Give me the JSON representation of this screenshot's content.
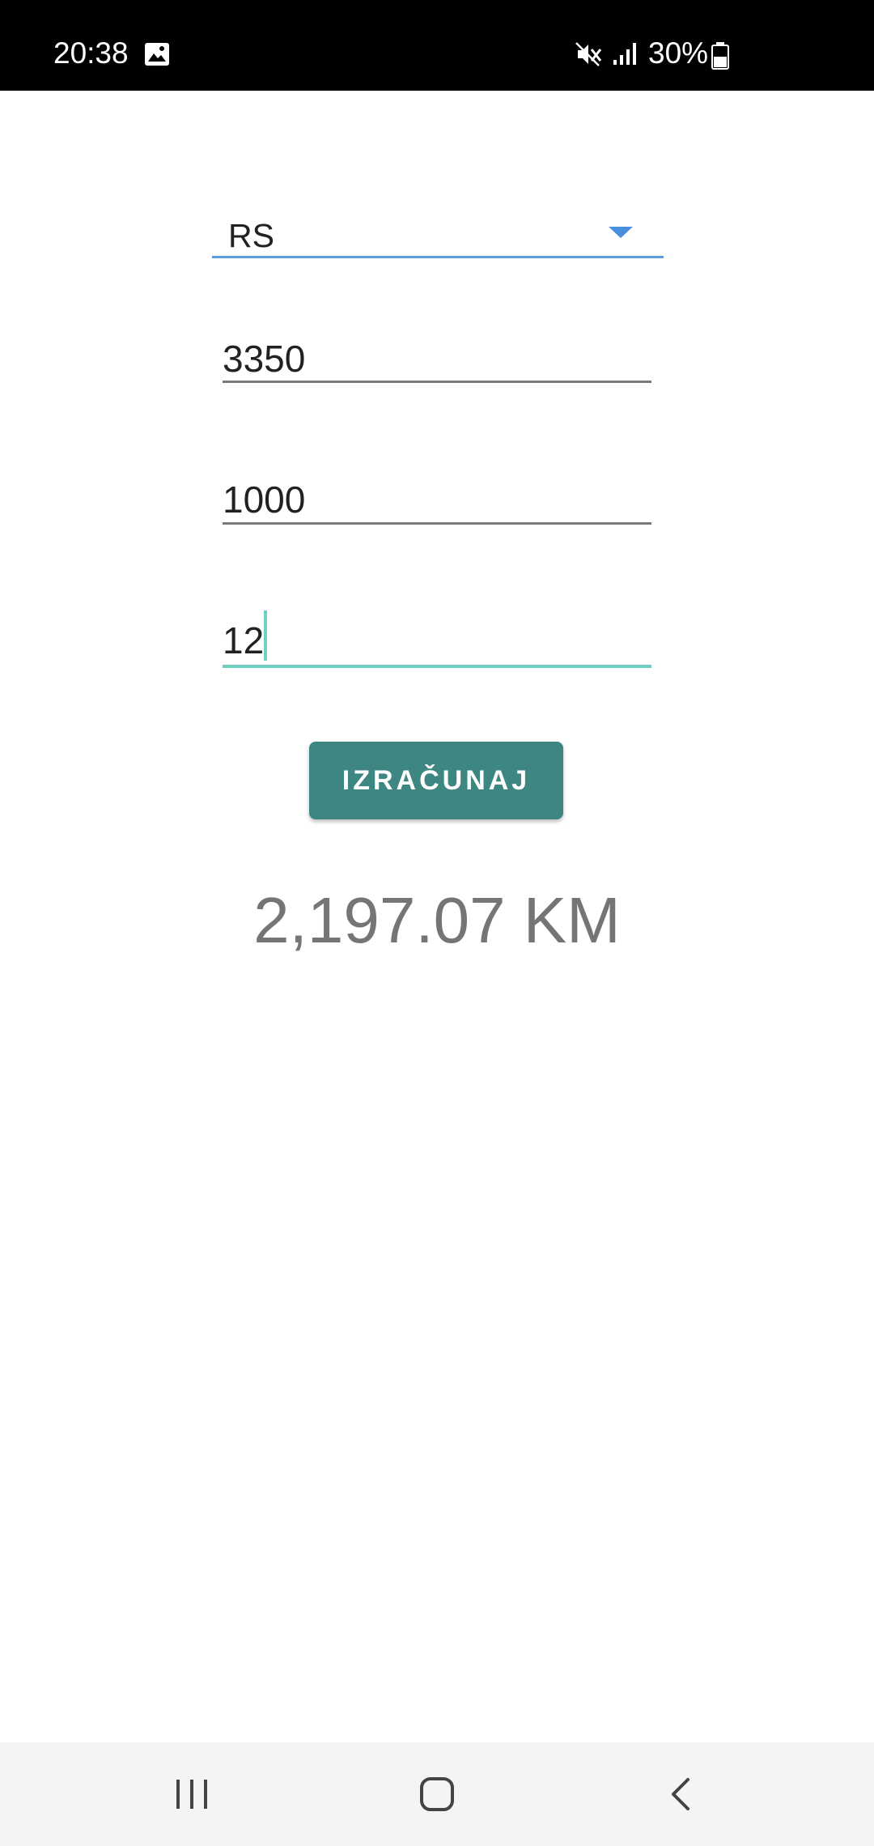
{
  "status_bar": {
    "time": "20:38",
    "battery_percent": "30%",
    "icons": [
      "gallery-icon",
      "mute-icon",
      "signal-icon",
      "battery-icon"
    ]
  },
  "form": {
    "region_select": {
      "value": "RS"
    },
    "field_1": {
      "value": "3350"
    },
    "field_2": {
      "value": "1000"
    },
    "field_3": {
      "value": "12"
    }
  },
  "calculate_button": {
    "label": "IZRAČUNAJ"
  },
  "result": {
    "text": "2,197.07 KM"
  },
  "nav_bar": {
    "icons": [
      "recent-apps-icon",
      "home-icon",
      "back-icon"
    ]
  },
  "colors": {
    "accent": "#3e8681",
    "focus_underline": "#6fd0c2",
    "spinner_accent": "#4a8fdd",
    "result_text": "#757575"
  }
}
